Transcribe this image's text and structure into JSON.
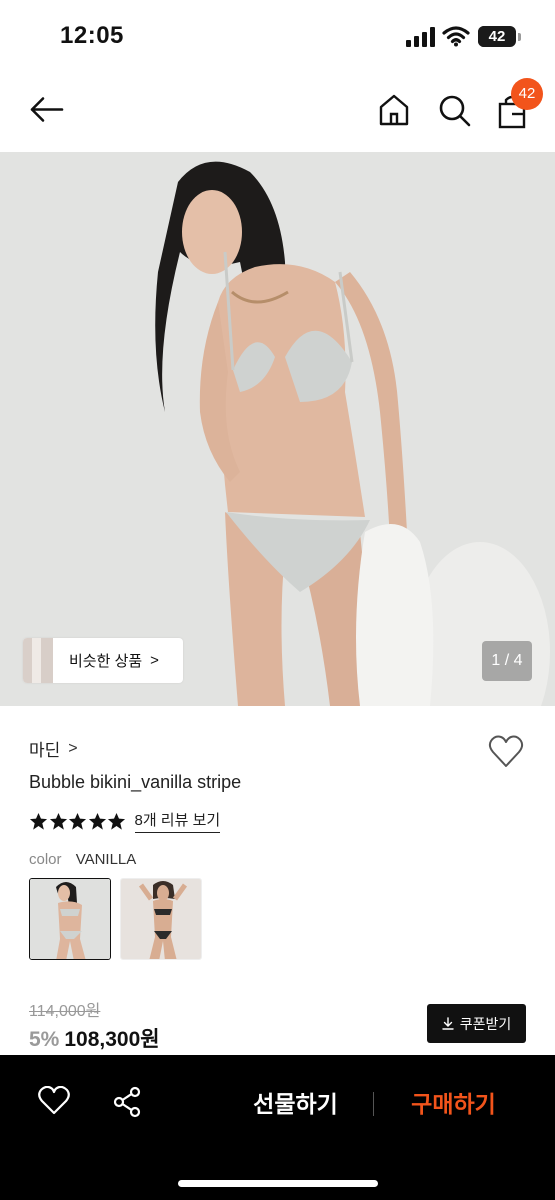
{
  "status_bar": {
    "time": "12:05",
    "battery": "42",
    "battery_level": 0.42
  },
  "nav": {
    "cart_count": "42"
  },
  "hero": {
    "similar_label": "비슷한 상품",
    "similar_chevron": ">",
    "pager": "1 / 4"
  },
  "product": {
    "brand": "마딘",
    "brand_chevron": ">",
    "name": "Bubble bikini_vanilla stripe",
    "rating_stars": 5,
    "review_link": "8개 리뷰 보기",
    "color_label": "color",
    "color_value": "VANILLA",
    "original_price": "114,000원",
    "discount": "5%",
    "price": "108,300원",
    "coupon_label": "쿠폰받기"
  },
  "bottom_bar": {
    "gift_label": "선물하기",
    "buy_label": "구매하기"
  },
  "colors": {
    "accent": "#f2541b",
    "bar": "#000000",
    "strike": "#999999"
  },
  "icons": [
    "back-arrow-icon",
    "home-icon",
    "search-icon",
    "shopping-bag-icon",
    "heart-icon",
    "star-icon",
    "download-icon",
    "share-icon",
    "chevron-right-icon",
    "cellular-signal-icon",
    "wifi-icon",
    "battery-icon"
  ]
}
